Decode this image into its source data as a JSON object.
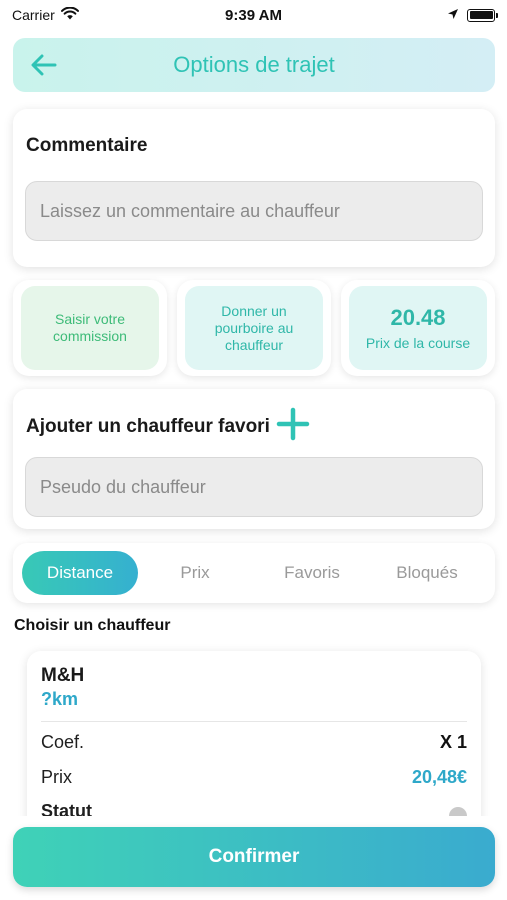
{
  "status_bar": {
    "carrier": "Carrier",
    "time": "9:39 AM"
  },
  "header": {
    "title": "Options de trajet"
  },
  "comment": {
    "title": "Commentaire",
    "placeholder": "Laissez un commentaire au chauffeur"
  },
  "tiles": {
    "commission": "Saisir votre commission",
    "tip": "Donner un pourboire au chauffeur",
    "price_value": "20.48",
    "price_label": "Prix de la course"
  },
  "favorite": {
    "title": "Ajouter un chauffeur favori",
    "placeholder": "Pseudo du chauffeur"
  },
  "tabs": [
    {
      "label": "Distance",
      "active": true
    },
    {
      "label": "Prix",
      "active": false
    },
    {
      "label": "Favoris",
      "active": false
    },
    {
      "label": "Bloqués",
      "active": false
    }
  ],
  "driver_section": {
    "label": "Choisir un chauffeur"
  },
  "driver": {
    "name": "M&H",
    "distance": "?km",
    "coef_label": "Coef.",
    "coef_value": "X 1",
    "price_label": "Prix",
    "price_value": "20,48€",
    "status_label": "Statut"
  },
  "confirm": {
    "label": "Confirmer"
  },
  "colors": {
    "accent_teal": "#2fc3b5",
    "accent_blue": "#2ea8c9",
    "commission_green": "#3dbb78"
  }
}
